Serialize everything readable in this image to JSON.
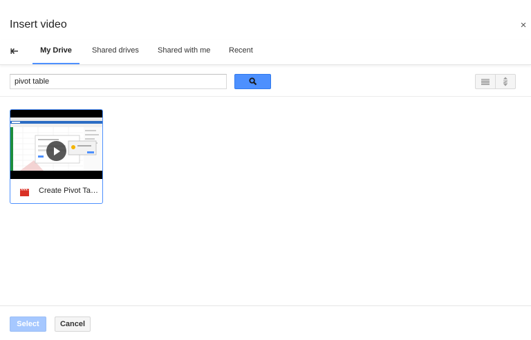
{
  "dialog": {
    "title": "Insert video",
    "close_label": "×"
  },
  "tabs": [
    {
      "label": "My Drive",
      "active": true
    },
    {
      "label": "Shared drives",
      "active": false
    },
    {
      "label": "Shared with me",
      "active": false
    },
    {
      "label": "Recent",
      "active": false
    }
  ],
  "search": {
    "value": "pivot table"
  },
  "results": [
    {
      "name": "Create Pivot Table..."
    }
  ],
  "footer": {
    "select_label": "Select",
    "cancel_label": "Cancel"
  },
  "colors": {
    "accent": "#4d90fe",
    "select_disabled": "#a6c8ff",
    "file_icon": "#d93025"
  },
  "icons": [
    "back-arrow-icon",
    "close-icon",
    "search-icon",
    "list-view-icon",
    "sort-icon",
    "play-icon",
    "film-icon"
  ]
}
